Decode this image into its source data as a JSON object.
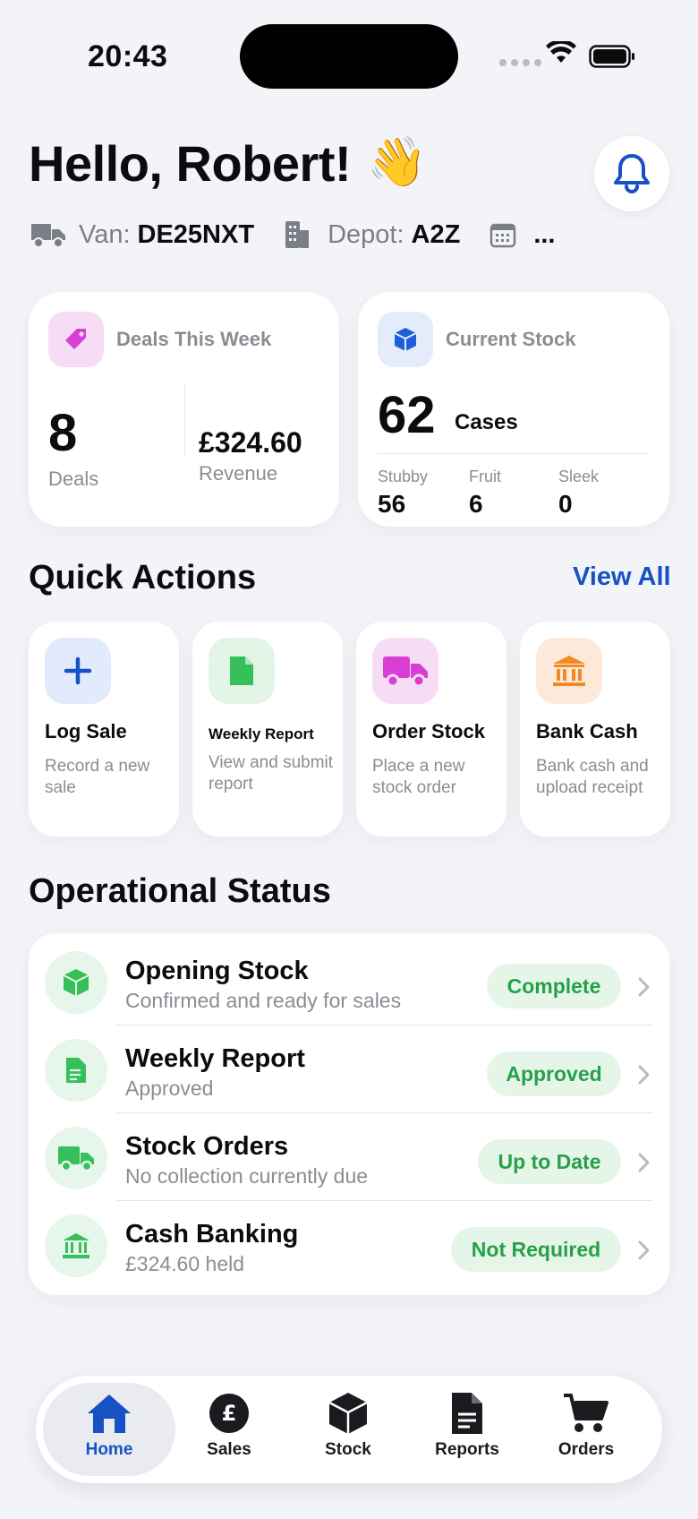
{
  "status_bar": {
    "time": "20:43"
  },
  "header": {
    "greeting": "Hello, Robert!",
    "wave_emoji": "👋",
    "van_label": "Van:",
    "van_value": "DE25NXT",
    "depot_label": "Depot:",
    "depot_value": "A2Z",
    "date_value": "..."
  },
  "summary": {
    "deals": {
      "title": "Deals This Week",
      "count": "8",
      "count_label": "Deals",
      "revenue": "£324.60",
      "revenue_label": "Revenue"
    },
    "stock": {
      "title": "Current Stock",
      "total": "62",
      "unit": "Cases",
      "breakdown": [
        {
          "label": "Stubby",
          "value": "56"
        },
        {
          "label": "Fruit",
          "value": "6"
        },
        {
          "label": "Sleek",
          "value": "0"
        }
      ]
    }
  },
  "quick_actions": {
    "title": "Quick Actions",
    "view_all": "View All",
    "items": [
      {
        "title": "Log Sale",
        "desc": "Record a new sale",
        "icon": "plus-icon"
      },
      {
        "title": "Weekly Report",
        "desc": "View and submit report",
        "icon": "document-icon"
      },
      {
        "title": "Order Stock",
        "desc": "Place a new stock order",
        "icon": "truck-icon"
      },
      {
        "title": "Bank Cash",
        "desc": "Bank cash and upload receipt",
        "icon": "bank-icon"
      }
    ]
  },
  "operational_status": {
    "title": "Operational Status",
    "items": [
      {
        "title": "Opening Stock",
        "subtitle": "Confirmed and ready for sales",
        "status": "Complete",
        "icon": "box-icon"
      },
      {
        "title": "Weekly Report",
        "subtitle": "Approved",
        "status": "Approved",
        "icon": "document-icon"
      },
      {
        "title": "Stock Orders",
        "subtitle": "No collection currently due",
        "status": "Up to Date",
        "icon": "truck-icon"
      },
      {
        "title": "Cash Banking",
        "subtitle": "£324.60 held",
        "status": "Not Required",
        "icon": "bank-icon"
      }
    ]
  },
  "tabs": [
    {
      "label": "Home",
      "icon": "home-icon",
      "active": true
    },
    {
      "label": "Sales",
      "icon": "pound-icon",
      "active": false
    },
    {
      "label": "Stock",
      "icon": "cube-icon",
      "active": false
    },
    {
      "label": "Reports",
      "icon": "document-icon",
      "active": false
    },
    {
      "label": "Orders",
      "icon": "cart-icon",
      "active": false
    }
  ],
  "colors": {
    "accent_blue": "#1652c4",
    "status_green": "#27a04a",
    "badge_green_bg": "#e5f6e9",
    "deals_pink": "#d63fd2",
    "stock_blue": "#1c5fd9",
    "report_green": "#35c05a",
    "order_magenta": "#d63fd2",
    "bank_orange": "#f08a24"
  }
}
